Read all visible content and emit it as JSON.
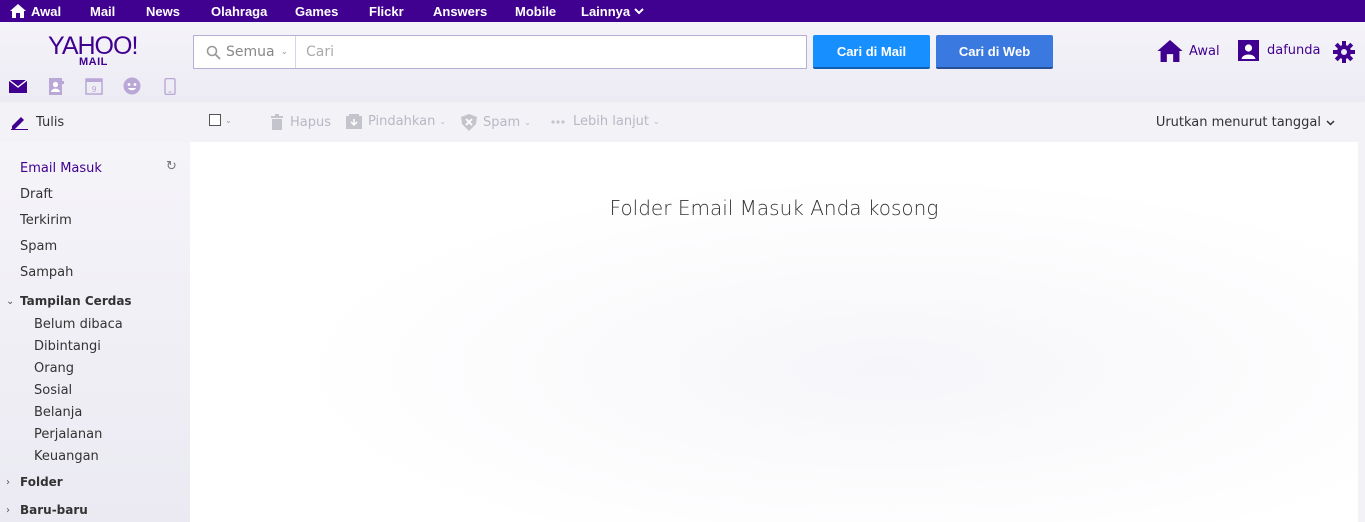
{
  "topnav": {
    "items": [
      {
        "label": "Awal",
        "icon": "home-icon"
      },
      {
        "label": "Mail"
      },
      {
        "label": "News"
      },
      {
        "label": "Olahraga"
      },
      {
        "label": "Games"
      },
      {
        "label": "Flickr"
      },
      {
        "label": "Answers"
      },
      {
        "label": "Mobile"
      },
      {
        "label": "Lainnya",
        "icon": "chevron-down-icon"
      }
    ]
  },
  "header": {
    "logo_main": "YAHOO!",
    "logo_sub": "MAIL",
    "search": {
      "scope": "Semua",
      "placeholder": "Cari",
      "value": ""
    },
    "buttons": {
      "search_mail": "Cari di Mail",
      "search_web": "Cari di Web"
    },
    "home_label": "Awal",
    "username": "dafunda",
    "apps": [
      "mail-icon",
      "contacts-icon",
      "calendar-icon",
      "messenger-icon",
      "mobile-icon"
    ],
    "calendar_day": "9"
  },
  "toolbar": {
    "compose": "Tulis",
    "delete": "Hapus",
    "move": "Pindahkan",
    "spam": "Spam",
    "more": "Lebih lanjut",
    "sort": "Urutkan menurut tanggal"
  },
  "sidebar": {
    "folders": [
      "Email Masuk",
      "Draft",
      "Terkirim",
      "Spam",
      "Sampah"
    ],
    "smart_views": {
      "title": "Tampilan Cerdas",
      "items": [
        "Belum dibaca",
        "Dibintangi",
        "Orang",
        "Sosial",
        "Belanja",
        "Perjalanan",
        "Keuangan"
      ]
    },
    "folder_section": "Folder",
    "recent_section": "Baru-baru"
  },
  "main": {
    "empty_message": "Folder Email Masuk Anda kosong"
  },
  "colors": {
    "brand": "#400090",
    "search_mail_button": "#188fff",
    "search_web_button": "#3a79df"
  }
}
